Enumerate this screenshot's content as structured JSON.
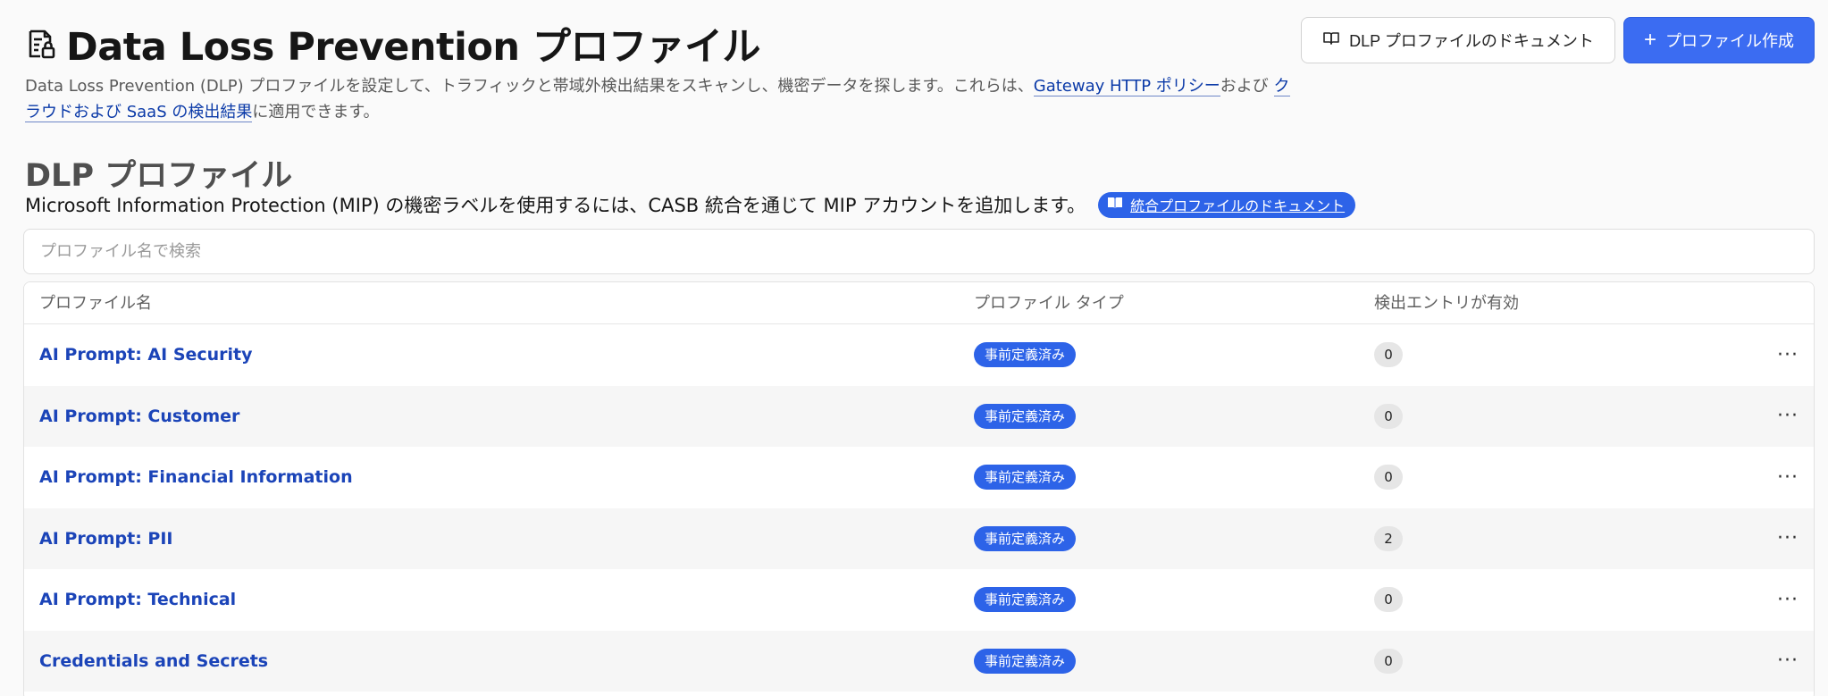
{
  "header": {
    "title": "Data Loss Prevention プロファイル",
    "title_icon": "document-lock-icon",
    "description_prefix": "Data Loss Prevention (DLP) プロファイルを設定して、トラフィックと帯域外検出結果をスキャンし、機密データを探します。これらは、",
    "description_link1": "Gateway HTTP ポリシー",
    "description_mid": "および ",
    "description_link2": "クラウドおよび SaaS の検出結果",
    "description_suffix": "に適用できます。"
  },
  "actions": {
    "doc_button_label": "DLP プロファイルのドキュメント",
    "doc_button_icon": "book-icon",
    "create_button_label": "プロファイル作成",
    "create_button_icon": "plus-icon"
  },
  "section": {
    "title": "DLP プロファイル",
    "mip_text": "Microsoft Information Protection (MIP) の機密ラベルを使用するには、CASB 統合を通じて MIP アカウントを追加します。",
    "integration_doc_label": "統合プロファイルのドキュメント",
    "integration_doc_icon": "book-icon"
  },
  "search": {
    "placeholder": "プロファイル名で検索",
    "value": ""
  },
  "table": {
    "columns": [
      "プロファイル名",
      "プロファイル タイプ",
      "検出エントリが有効"
    ],
    "rows": [
      {
        "name": "AI Prompt: AI Security",
        "type": "事前定義済み",
        "count": "0"
      },
      {
        "name": "AI Prompt: Customer",
        "type": "事前定義済み",
        "count": "0"
      },
      {
        "name": "AI Prompt: Financial Information",
        "type": "事前定義済み",
        "count": "0"
      },
      {
        "name": "AI Prompt: PII",
        "type": "事前定義済み",
        "count": "2"
      },
      {
        "name": "AI Prompt: Technical",
        "type": "事前定義済み",
        "count": "0"
      },
      {
        "name": "Credentials and Secrets",
        "type": "事前定義済み",
        "count": "0"
      }
    ],
    "row_menu_glyph": "···"
  },
  "colors": {
    "accent": "#2d63e8",
    "link": "#1b44b8",
    "background": "#fafafa"
  }
}
